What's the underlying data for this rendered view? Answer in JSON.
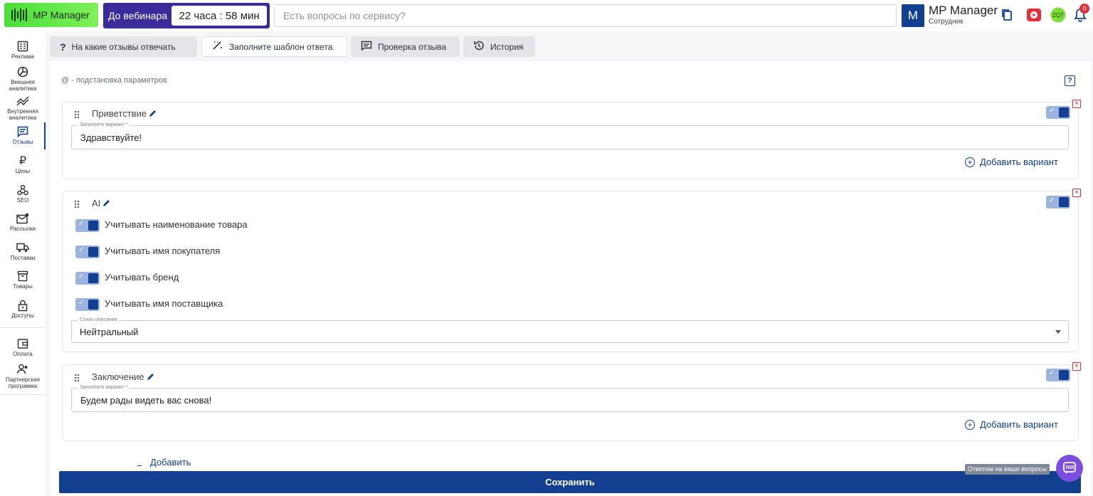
{
  "header": {
    "logo_text": "MP Manager",
    "webinar_label": "До вебинара",
    "webinar_timer": "22 часа : 58 мин",
    "search_placeholder": "Есть вопросы по сервису?",
    "user_initial": "M",
    "user_name": "MP Manager",
    "user_role": "Сотрудник",
    "notification_count": "0",
    "icons": [
      "copy-icon",
      "video-play-icon",
      "avatar-icon",
      "bell-icon"
    ]
  },
  "sidebar": {
    "items": [
      {
        "label": "Реклама",
        "icon": "ads-icon"
      },
      {
        "label": "Внешняя аналитика",
        "icon": "pie-chart-icon"
      },
      {
        "label": "Внутренняя аналитика",
        "icon": "trend-icon"
      },
      {
        "label": "Отзывы",
        "icon": "reviews-icon"
      },
      {
        "label": "Цены",
        "icon": "ruble-icon"
      },
      {
        "label": "SEO",
        "icon": "seo-icon"
      },
      {
        "label": "Рассылки",
        "icon": "mail-icon"
      },
      {
        "label": "Поставки",
        "icon": "truck-icon"
      },
      {
        "label": "Товары",
        "icon": "box-icon"
      },
      {
        "label": "Доступы",
        "icon": "lock-icon"
      },
      {
        "label": "Оплата",
        "icon": "wallet-icon"
      },
      {
        "label": "Партнерская программа",
        "icon": "partners-icon"
      }
    ],
    "active": "Отзывы"
  },
  "tabs": [
    {
      "label": "На какие отзывы отвечать",
      "icon": "question-icon"
    },
    {
      "label": "Заполните шаблон ответа",
      "icon": "magic-icon",
      "active": true
    },
    {
      "label": "Проверка отзыва",
      "icon": "comment-icon"
    },
    {
      "label": "История",
      "icon": "history-icon"
    }
  ],
  "main": {
    "hint": "@ - подстановка параметров",
    "greeting": {
      "title": "Приветствие",
      "field_label": "Заполните вариант *",
      "value": "Здравствуйте!",
      "add_variant": "Добавить вариант",
      "enabled": true
    },
    "ai": {
      "title": "AI",
      "enabled": true,
      "options": [
        {
          "label": "Учитывать наименование товара",
          "checked": true
        },
        {
          "label": "Учитывать имя покупателя",
          "checked": true
        },
        {
          "label": "Учитывать бренд",
          "checked": true
        },
        {
          "label": "Учитывать имя поставщика",
          "checked": true
        }
      ],
      "style_label": "Стиль описания",
      "style_value": "Нейтральный"
    },
    "conclusion": {
      "title": "Заключение",
      "field_label": "Заполните вариант *",
      "value": "Будем рады видеть вас снова!",
      "add_variant": "Добавить вариант",
      "enabled": true
    },
    "add_label": "Добавить",
    "save_label": "Сохранить",
    "chat_tooltip": "Ответим на ваши вопросы"
  },
  "colors": {
    "primary": "#123f8f",
    "logo_green": "#4ade3a",
    "webinar_purple": "#3a2a9a",
    "chat_purple": "#7c4fe0",
    "danger": "#dd3333"
  }
}
